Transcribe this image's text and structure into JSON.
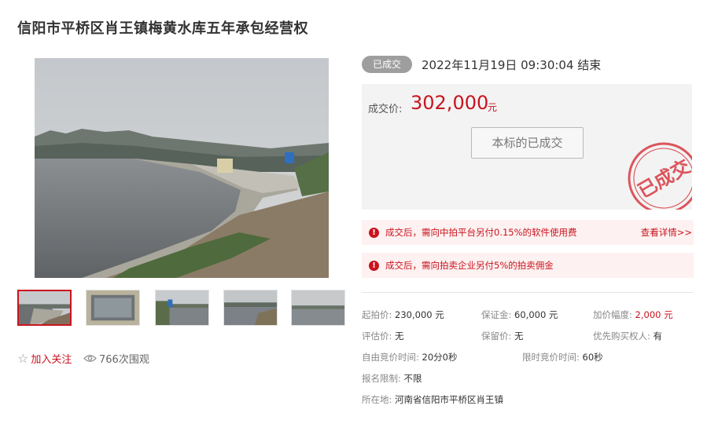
{
  "title": "信阳市平桥区肖王镇梅黄水库五年承包经营权",
  "status": {
    "badge": "已成交",
    "end_time": "2022年11月19日  09:30:04 结束"
  },
  "price": {
    "label": "成交价:",
    "value": "302,000",
    "unit": "元",
    "button": "本标的已成交",
    "stamp_text": "已成交"
  },
  "notices": [
    {
      "text": "成交后，需向中拍平台另付0.15%的软件使用费",
      "link": "查看详情>>"
    },
    {
      "text": "成交后，需向拍卖企业另付5%的拍卖佣金"
    }
  ],
  "actions": {
    "follow": "加入关注",
    "views": "766次围观"
  },
  "info": {
    "start_price_label": "起拍价:",
    "start_price": "230,000 元",
    "deposit_label": "保证金:",
    "deposit": "60,000 元",
    "increment_label": "加价幅度:",
    "increment": "2,000 元",
    "appraisal_label": "评估价:",
    "appraisal": "无",
    "reserve_label": "保留价:",
    "reserve": "无",
    "priority_label": "优先购买权人:",
    "priority": "有",
    "free_bid_label": "自由竞价时间:",
    "free_bid": "20分0秒",
    "limited_bid_label": "限时竞价时间:",
    "limited_bid": "60秒",
    "signup_label": "报名限制:",
    "signup": "不限",
    "location_label": "所在地:",
    "location": "河南省信阳市平桥区肖王镇"
  },
  "colors": {
    "accent": "#c9141e",
    "badge_gray": "#9e9e9e",
    "price_box_bg": "#f3f3f3",
    "notice_bg": "#fdf1f1"
  },
  "icons": [
    "star-icon",
    "eye-icon",
    "warning-icon"
  ]
}
